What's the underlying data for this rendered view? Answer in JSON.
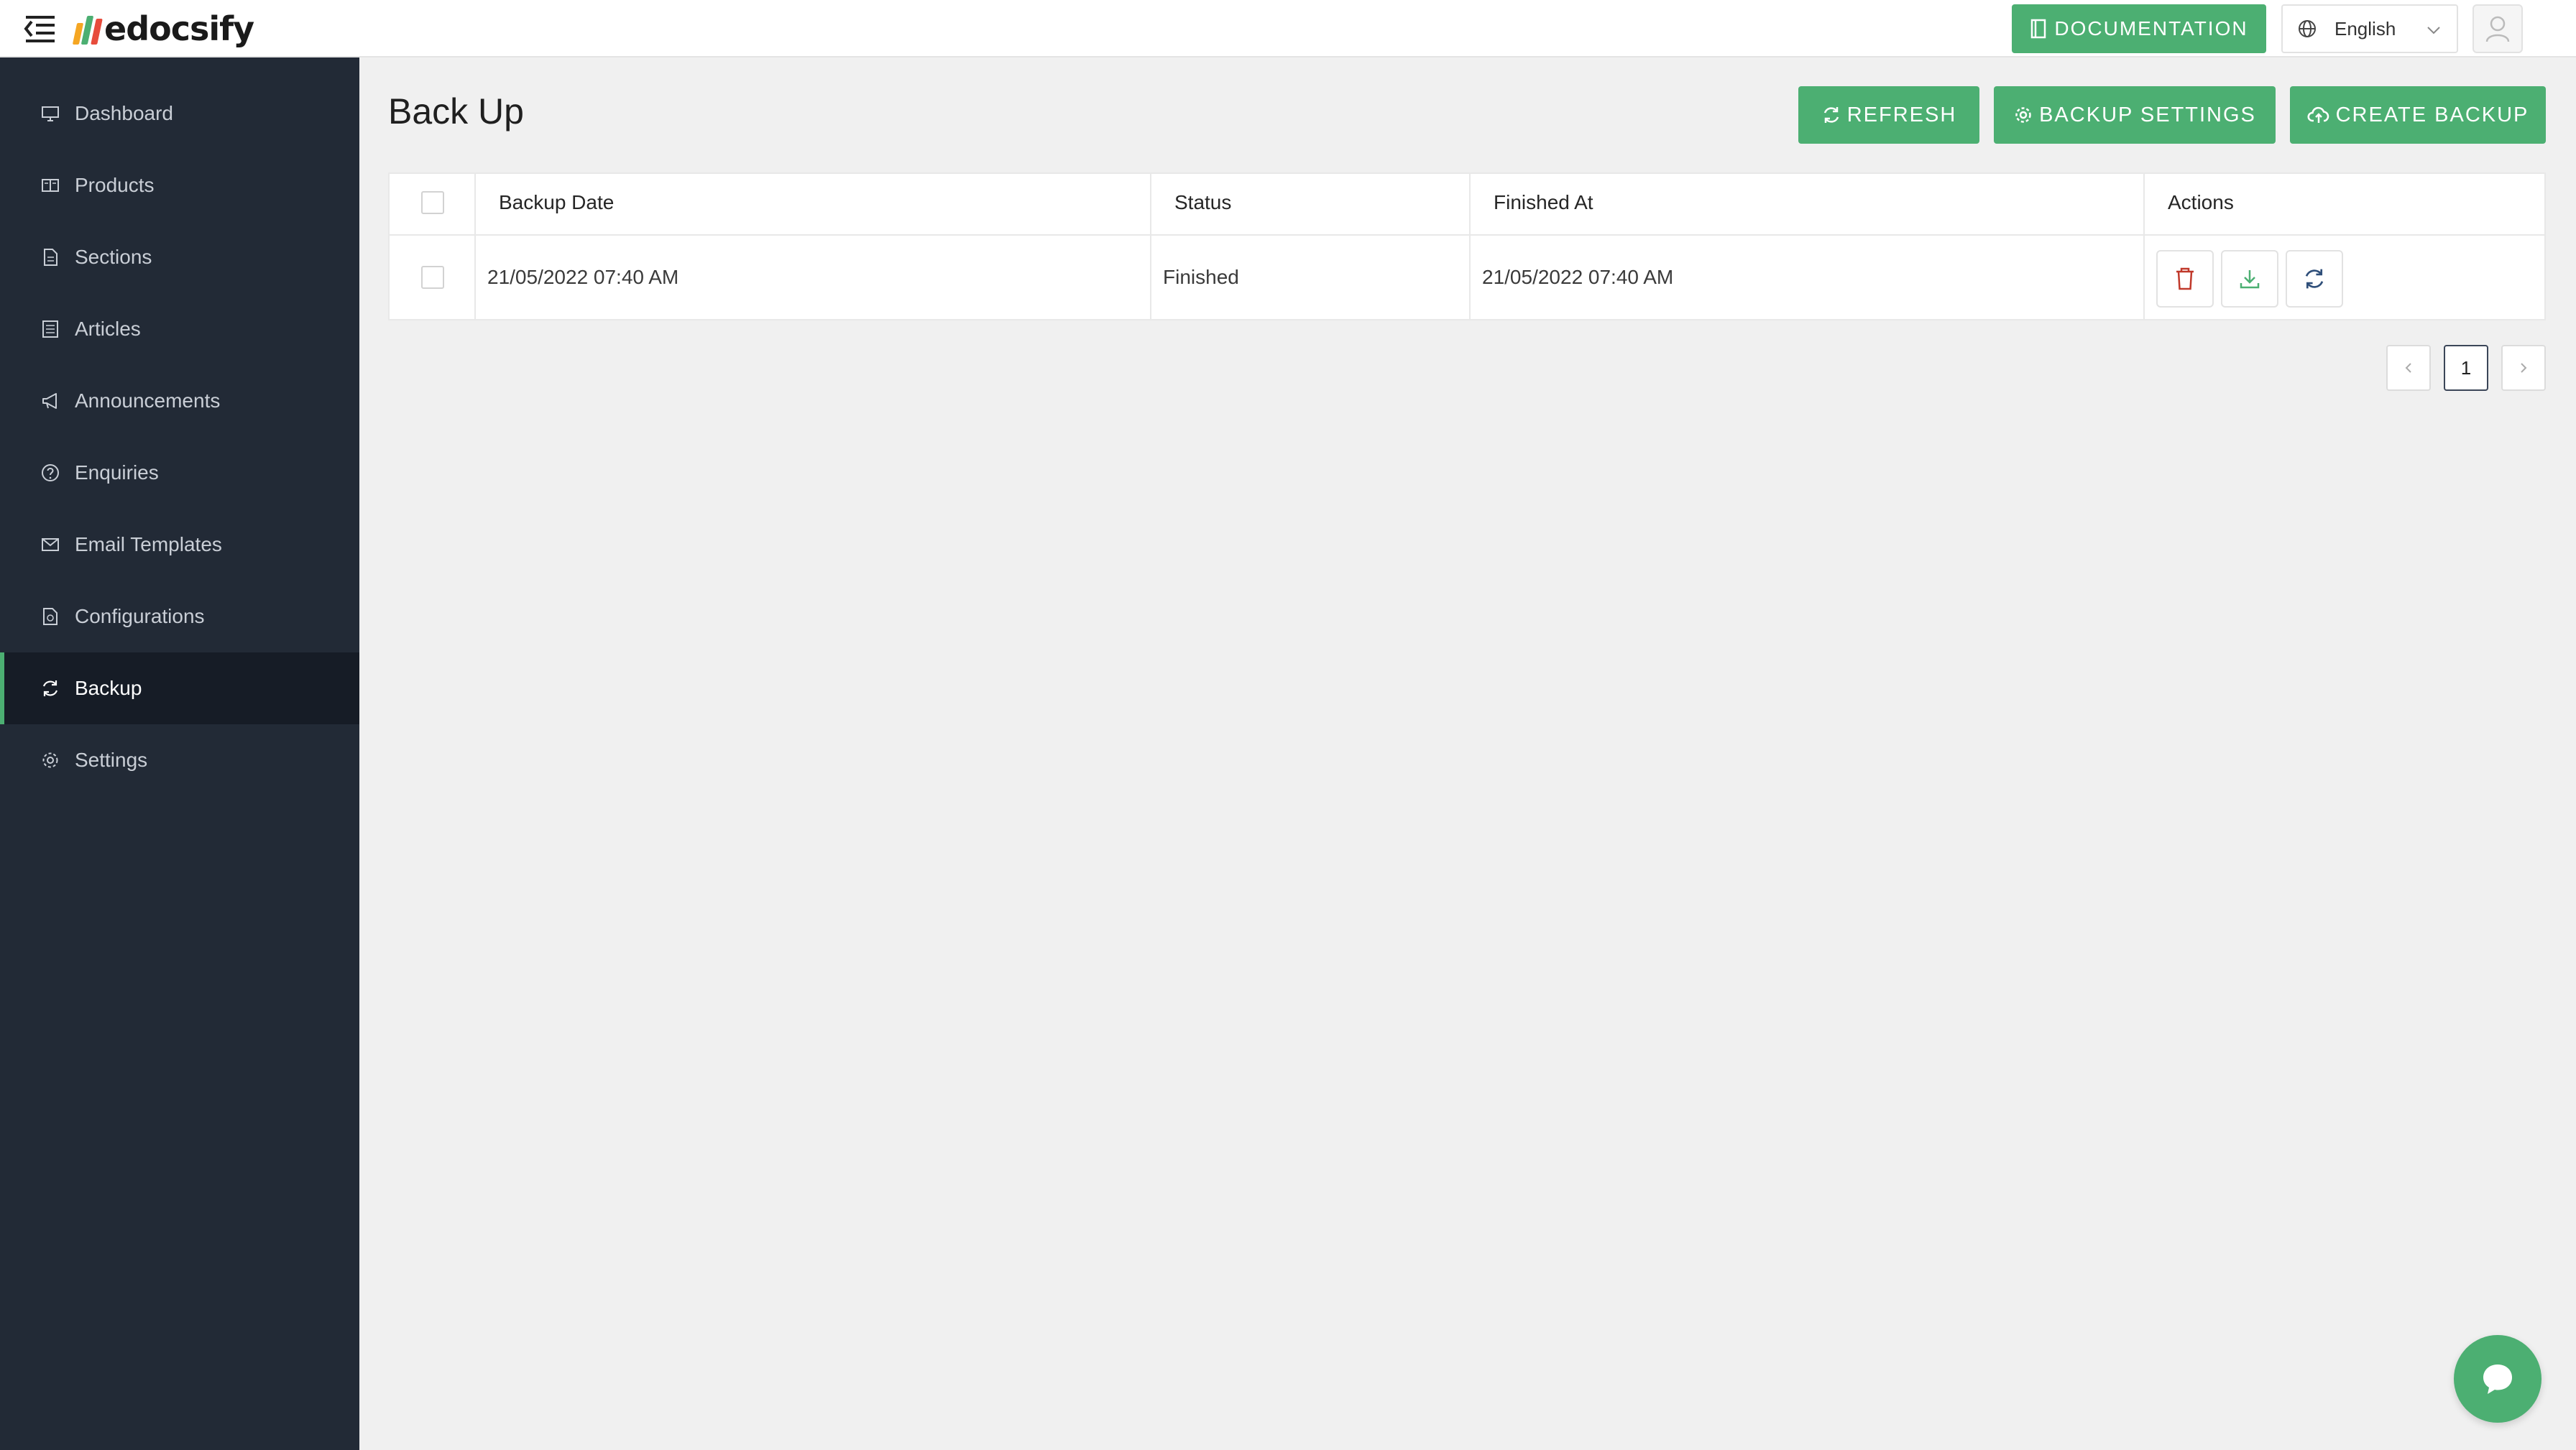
{
  "header": {
    "logo_text": "edocsify",
    "documentation_label": "DOCUMENTATION",
    "language": "English"
  },
  "sidebar": {
    "items": [
      {
        "label": "Dashboard",
        "icon": "monitor-icon"
      },
      {
        "label": "Products",
        "icon": "book-icon"
      },
      {
        "label": "Sections",
        "icon": "file-icon"
      },
      {
        "label": "Articles",
        "icon": "list-icon"
      },
      {
        "label": "Announcements",
        "icon": "megaphone-icon"
      },
      {
        "label": "Enquiries",
        "icon": "question-icon"
      },
      {
        "label": "Email Templates",
        "icon": "mail-icon"
      },
      {
        "label": "Configurations",
        "icon": "config-icon"
      },
      {
        "label": "Backup",
        "icon": "sync-icon",
        "active": true
      },
      {
        "label": "Settings",
        "icon": "gear-icon"
      }
    ]
  },
  "main": {
    "title": "Back Up",
    "buttons": {
      "refresh": "REFRESH",
      "backup_settings": "BACKUP SETTINGS",
      "create_backup": "CREATE BACKUP"
    },
    "table": {
      "columns": [
        "Backup Date",
        "Status",
        "Finished At",
        "Actions"
      ],
      "rows": [
        {
          "backup_date": "21/05/2022 07:40 AM",
          "status": "Finished",
          "finished_at": "21/05/2022 07:40 AM"
        }
      ]
    },
    "pagination": {
      "current_page": "1"
    }
  },
  "colors": {
    "accent": "#4caf72",
    "sidebar_bg": "#222a36",
    "sidebar_active_bg": "#161c26",
    "page_bg": "#f0f0f0",
    "delete": "#c0392b"
  }
}
